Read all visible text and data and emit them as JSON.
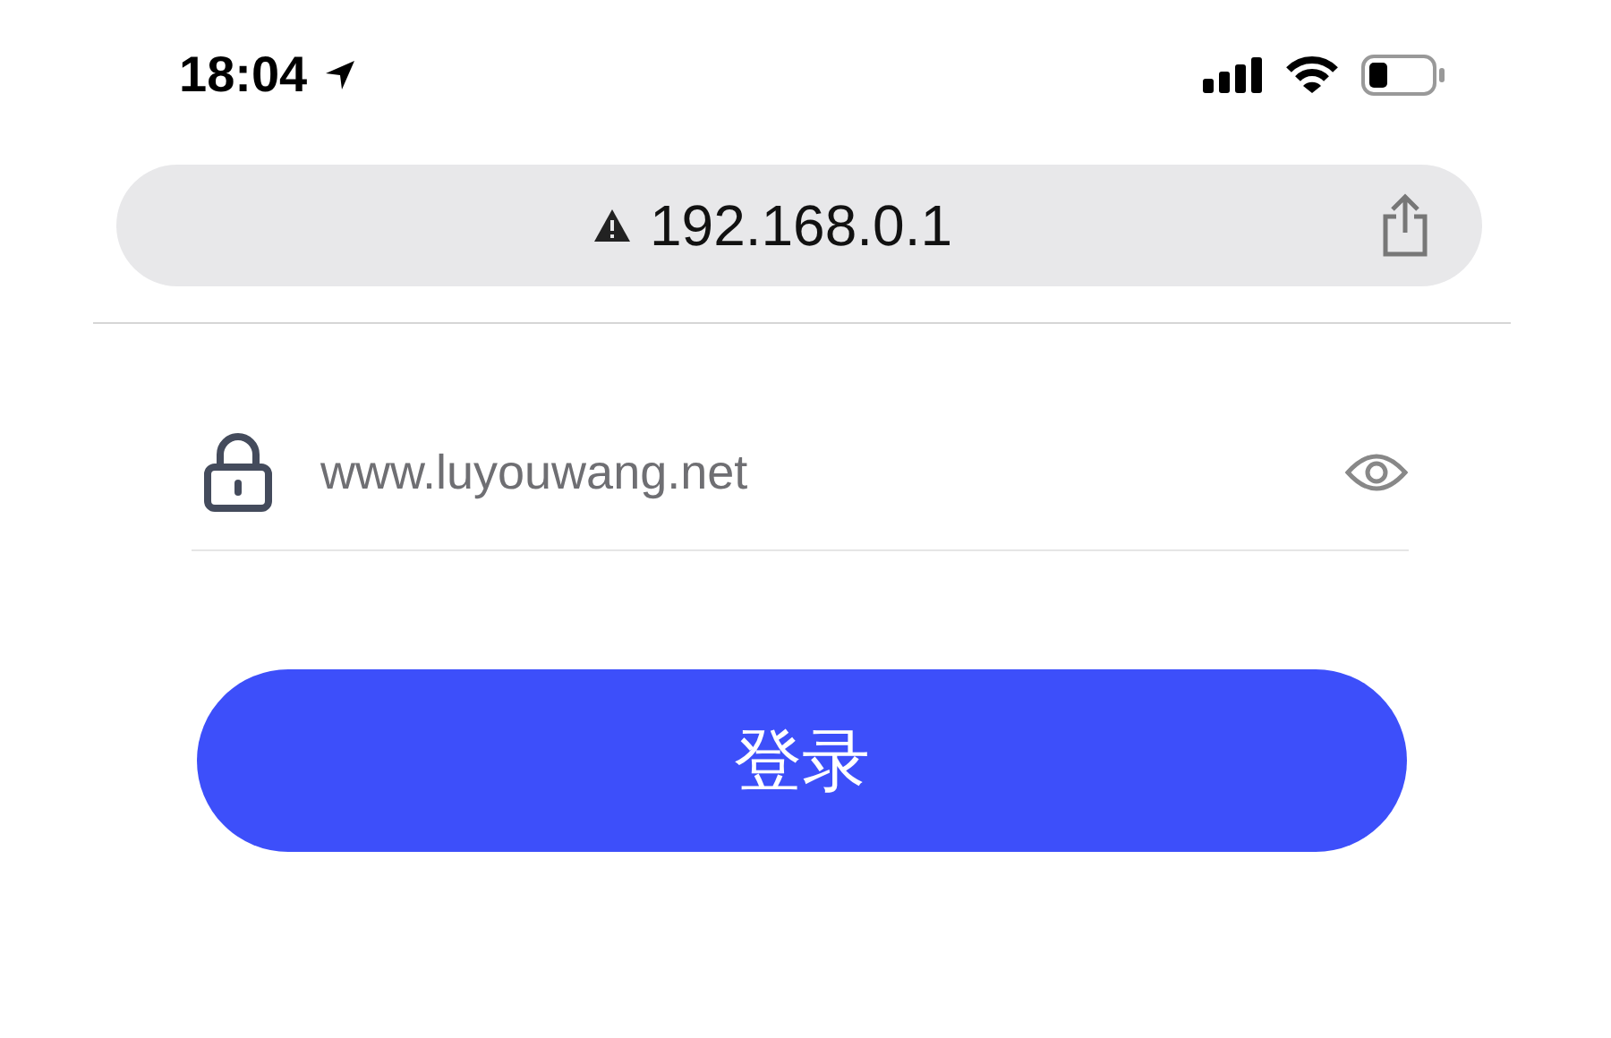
{
  "status_bar": {
    "time": "18:04"
  },
  "address_bar": {
    "address": "192.168.0.1"
  },
  "password_field": {
    "placeholder": "www.luyouwang.net"
  },
  "login_button": {
    "label": "登录"
  }
}
